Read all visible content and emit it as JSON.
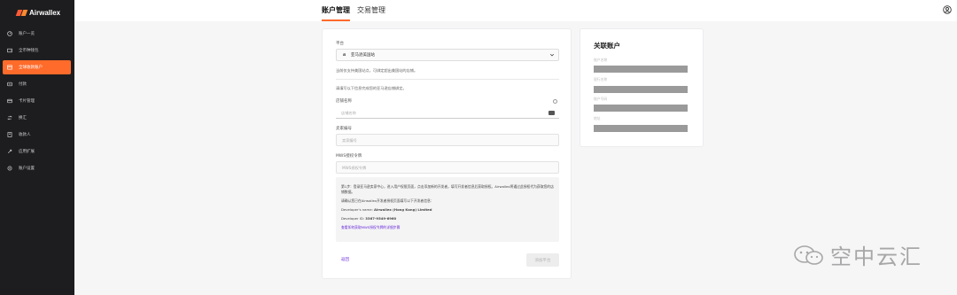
{
  "app": {
    "logo_text": "Airwallex"
  },
  "sidebar": {
    "items": [
      {
        "label": "账户一览",
        "icon": "dashboard-icon",
        "active": false
      },
      {
        "label": "全币种钱包",
        "icon": "wallet-icon",
        "active": false
      },
      {
        "label": "全球收款账户",
        "icon": "bank-icon",
        "active": true
      },
      {
        "label": "付款",
        "icon": "payment-icon",
        "active": false
      },
      {
        "label": "卡片管理",
        "icon": "card-icon",
        "active": false
      },
      {
        "label": "换汇",
        "icon": "exchange-icon",
        "active": false
      },
      {
        "label": "收款人",
        "icon": "contacts-icon",
        "active": false
      },
      {
        "label": "应用扩展",
        "icon": "plugin-icon",
        "active": false
      },
      {
        "label": "账户设置",
        "icon": "settings-icon",
        "active": false
      }
    ]
  },
  "header": {
    "tabs": [
      {
        "label": "账户管理",
        "active": true
      },
      {
        "label": "交易管理",
        "active": false
      }
    ]
  },
  "form": {
    "platform_label": "平台",
    "platform_value": "亚马逊美国站",
    "platform_logo": "a",
    "note1": "当前仅支持美国站点，可绑定超出美国站的店铺。",
    "note2": "请填写以下信息完成您的亚马逊店铺绑定。",
    "store_name_label": "店铺名称",
    "store_name_placeholder": "店铺名称",
    "seller_id_label": "卖家编号",
    "seller_id_placeholder": "卖家编号",
    "mws_label": "MWS授权令牌",
    "mws_placeholder": "MWS授权令牌",
    "info_p1": "第1步：登录亚马逊卖家中心，进入用户权限页面，点击添加新的开发者，填写开发者信息后获取授权。Airwallex将通过此授权代为获取您的店铺数据。",
    "info_p2": "请确认您已在Airwallex开发者授权页面填写以下开发者信息：",
    "dev_name_label": "Developer's name:",
    "dev_name_value": "Airwallex (Hong Kong) Limited",
    "dev_id_label": "Developer ID:",
    "dev_id_value": "3367-9549-6960",
    "info_link": "查看如何获取MWS授权令牌的详细步骤",
    "back_label": "返回",
    "submit_label": "添加平台"
  },
  "linked": {
    "title": "关联账户",
    "fields": [
      "账户名称",
      "银行名称",
      "账户号码",
      "地址"
    ]
  },
  "watermark": {
    "text": "空中云汇"
  }
}
